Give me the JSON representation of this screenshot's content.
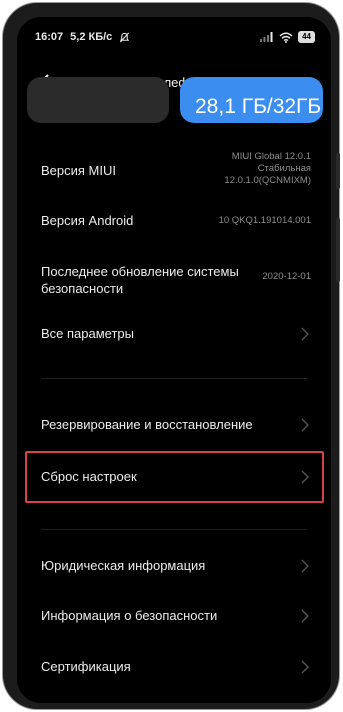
{
  "status": {
    "time": "16:07",
    "speed": "5,2 КБ/с",
    "battery": "44"
  },
  "header": {
    "title": "О телефоне"
  },
  "storage_card": {
    "text": "28,1 ГБ/32ГБ"
  },
  "rows": {
    "miui": {
      "title": "Версия MIUI",
      "value_line1": "MIUI Global 12.0.1",
      "value_line2": "Стабильная",
      "value_line3": "12.0.1.0(QCNMIXM)"
    },
    "android": {
      "title": "Версия Android",
      "value": "10 QKQ1.191014.001"
    },
    "security_update": {
      "title_line1": "Последнее обновление системы",
      "title_line2": "безопасности",
      "value": "2020-12-01"
    },
    "all_params": {
      "title": "Все параметры"
    },
    "backup": {
      "title": "Резервирование и восстановление"
    },
    "reset": {
      "title": "Сброс настроек"
    },
    "legal": {
      "title": "Юридическая информация"
    },
    "safety": {
      "title": "Информация о безопасности"
    },
    "cert": {
      "title": "Сертификация"
    }
  },
  "colors": {
    "accent": "#3b8df0",
    "highlight": "#d9414a",
    "background": "#000000"
  }
}
